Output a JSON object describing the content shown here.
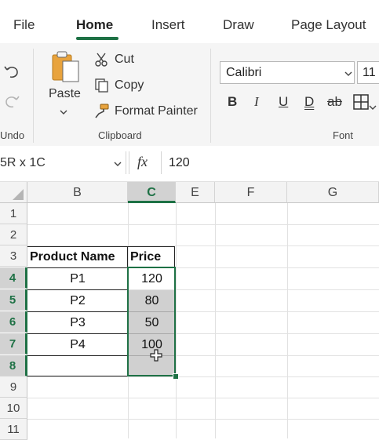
{
  "tabs": [
    {
      "label": "File"
    },
    {
      "label": "Home"
    },
    {
      "label": "Insert"
    },
    {
      "label": "Draw"
    },
    {
      "label": "Page Layout"
    }
  ],
  "ribbon": {
    "undo_group_label": "Undo",
    "paste_label": "Paste",
    "cut_label": "Cut",
    "copy_label": "Copy",
    "format_painter_label": "Format Painter",
    "clipboard_group_label": "Clipboard",
    "font_name": "Calibri",
    "font_size": "11",
    "font_group_label": "Font",
    "bold": "B",
    "italic": "I",
    "underline": "U",
    "double_underline": "D",
    "strikethrough": "ab"
  },
  "formula_bar": {
    "name_box": "5R x 1C",
    "fx": "fx",
    "value": "120"
  },
  "columns": [
    "B",
    "C",
    "E",
    "F",
    "G"
  ],
  "rows": [
    "1",
    "2",
    "3",
    "4",
    "5",
    "6",
    "7",
    "8",
    "9",
    "10",
    "11"
  ],
  "table": {
    "headers": [
      "Product Name",
      "Price"
    ],
    "rows": [
      {
        "product": "P1",
        "price": "120"
      },
      {
        "product": "P2",
        "price": "80"
      },
      {
        "product": "P3",
        "price": "50"
      },
      {
        "product": "P4",
        "price": "100"
      }
    ]
  },
  "colors": {
    "accent": "#1e7145",
    "selection_fill": "#d0d0d0"
  }
}
